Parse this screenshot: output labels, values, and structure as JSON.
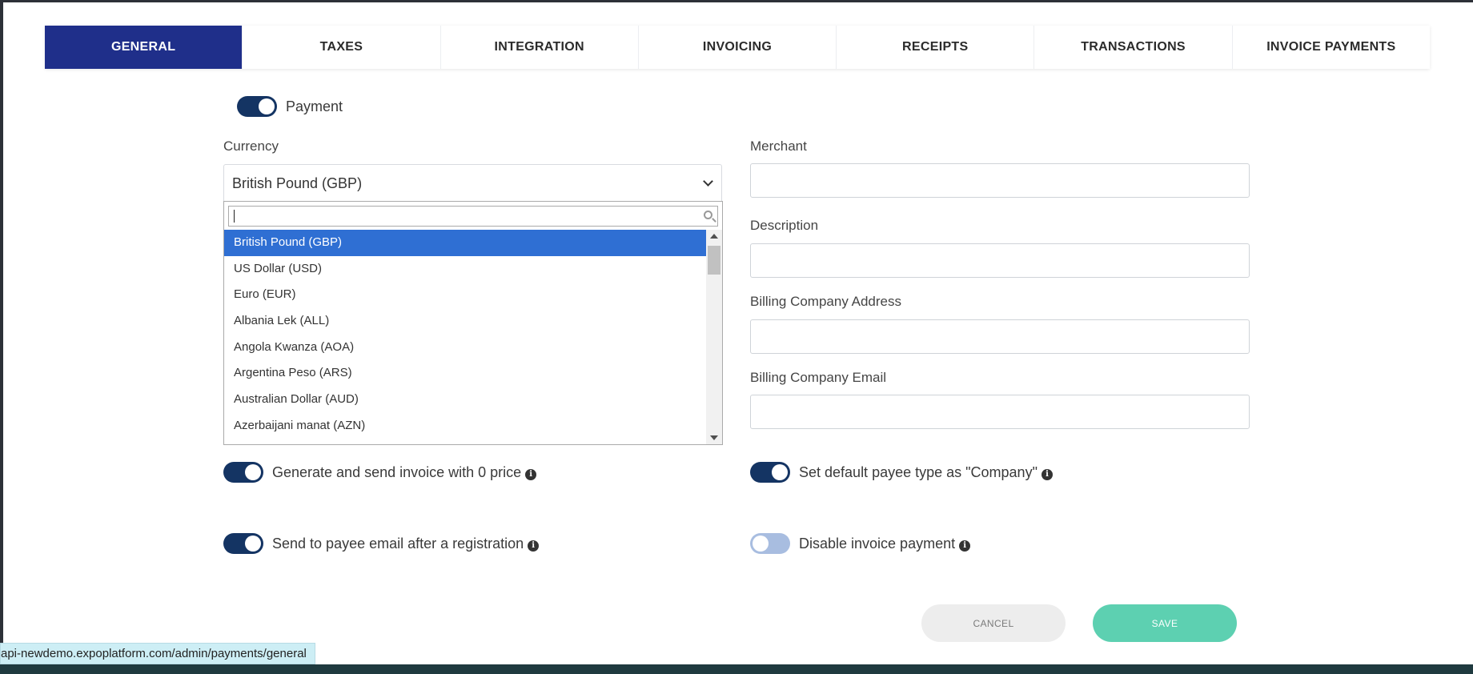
{
  "tabs": [
    {
      "label": "GENERAL",
      "active": true
    },
    {
      "label": "TAXES",
      "active": false
    },
    {
      "label": "INTEGRATION",
      "active": false
    },
    {
      "label": "INVOICING",
      "active": false
    },
    {
      "label": "RECEIPTS",
      "active": false
    },
    {
      "label": "TRANSACTIONS",
      "active": false
    },
    {
      "label": "INVOICE PAYMENTS",
      "active": false
    }
  ],
  "payment_toggle": {
    "label": "Payment",
    "on": true
  },
  "currency": {
    "label": "Currency",
    "selected": "British Pound (GBP)",
    "search_value": "",
    "options": [
      "British Pound (GBP)",
      "US Dollar (USD)",
      "Euro (EUR)",
      "Albania Lek (ALL)",
      "Angola Kwanza (AOA)",
      "Argentina Peso (ARS)",
      "Australian Dollar (AUD)",
      "Azerbaijani manat (AZN)"
    ]
  },
  "merchant": {
    "label": "Merchant",
    "value": ""
  },
  "description": {
    "label": "Description",
    "value": ""
  },
  "billing_address": {
    "label": "Billing Company Address",
    "value": ""
  },
  "billing_email": {
    "label": "Billing Company Email",
    "value": ""
  },
  "options": {
    "generate_invoice": {
      "label": "Generate and send invoice with 0 price",
      "on": true
    },
    "send_payee_email": {
      "label": "Send to payee email after a registration",
      "on": true
    },
    "default_payee_company": {
      "label": "Set default payee type as \"Company\"",
      "on": true
    },
    "disable_invoice_payment": {
      "label": "Disable invoice payment",
      "on": false
    }
  },
  "buttons": {
    "cancel": "CANCEL",
    "save": "SAVE"
  },
  "status_url": "api-newdemo.expoplatform.com/admin/payments/general",
  "colors": {
    "active_tab": "#1f2f8a",
    "toggle_on": "#143463",
    "toggle_off": "#a8bde0",
    "selected_option": "#2f6fd3",
    "save_button": "#5dd0b1"
  },
  "icons": [
    "chevron-down-icon",
    "search-icon",
    "info-icon",
    "scroll-up-icon",
    "scroll-down-icon"
  ]
}
